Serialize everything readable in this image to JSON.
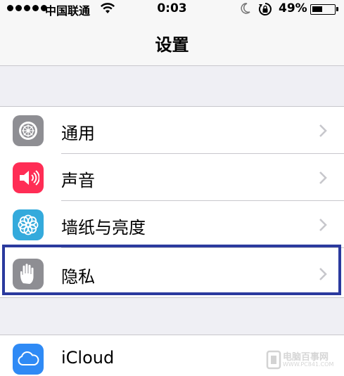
{
  "status_bar": {
    "carrier": "中国联通",
    "time": "0:03",
    "battery_percent": "49%",
    "battery_level": 0.49
  },
  "nav": {
    "title": "设置"
  },
  "groups": [
    {
      "items": [
        {
          "label": "通用",
          "icon": "gear-icon",
          "color": "#8e8e93"
        },
        {
          "label": "声音",
          "icon": "speaker-icon",
          "color": "#ff2d55"
        },
        {
          "label": "墙纸与亮度",
          "icon": "flower-icon",
          "color": "#34aadc"
        },
        {
          "label": "隐私",
          "icon": "hand-icon",
          "color": "#8e8e93"
        }
      ]
    },
    {
      "items": [
        {
          "label": "iCloud",
          "icon": "cloud-icon",
          "color": "#2f8af5"
        }
      ]
    }
  ],
  "highlight": {
    "target": "隐私",
    "color": "#2b3a9e"
  },
  "watermark": {
    "text": "电脑百事网",
    "url": "WWW.PC841.COM"
  }
}
